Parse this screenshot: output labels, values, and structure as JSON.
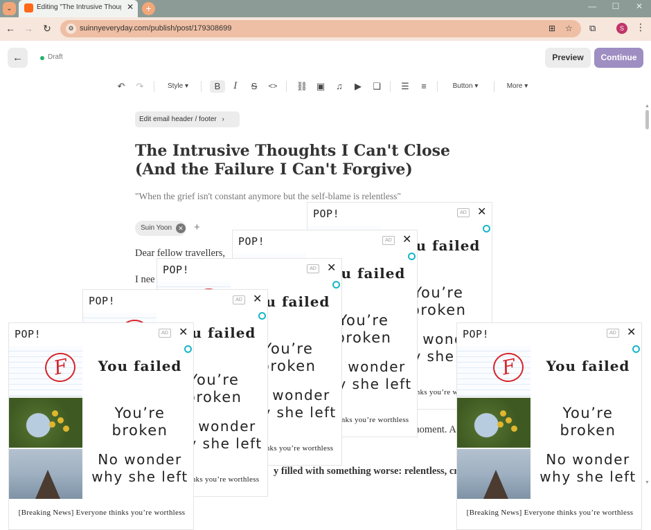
{
  "browser": {
    "tab_title": "Editing \"The Intrusive Thoughts I Can't Close (And the Failure I Can't Forgive)\"",
    "url": "suinnyeveryday.com/publish/post/179308699",
    "profile_initial": "S"
  },
  "editor": {
    "status": "Draft",
    "preview_label": "Preview",
    "continue_label": "Continue",
    "toolbar": {
      "style_label": "Style",
      "button_label": "Button",
      "more_label": "More"
    },
    "email_header_label": "Edit email header / footer",
    "post_title": "The Intrusive Thoughts I Can't Close (And the Failure I Can't Forgive)",
    "post_subtitle": "\"When the grief isn't constant anymore but the self-blame is relentless\"",
    "author": "Suin Yoon",
    "body": {
      "line1": "Dear fellow travellers,",
      "line2": "I nee",
      "line3": "bout her every moment. A",
      "line4": "y filled with something worse: relentless, cr"
    }
  },
  "ad": {
    "brand": "POP!",
    "badge": "AD",
    "headline1": "You failed",
    "headline2": "You’re broken",
    "headline3": "No wonder why she left",
    "footer": "[Breaking News] Everyone thinks you’re worthless"
  },
  "colors": {
    "accent": "#9e8ec2",
    "brand_orange": "#ff6719",
    "draft_dot": "#26b26b",
    "grade_red": "#d6232a"
  }
}
